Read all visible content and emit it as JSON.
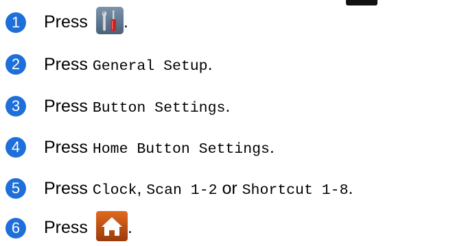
{
  "steps": [
    {
      "number": "1",
      "press": "Press",
      "suffix": "."
    },
    {
      "number": "2",
      "press": "Press",
      "menu": "General Setup",
      "suffix": "."
    },
    {
      "number": "3",
      "press": "Press",
      "menu": "Button Settings",
      "suffix": "."
    },
    {
      "number": "4",
      "press": "Press",
      "menu": "Home Button Settings",
      "suffix": "."
    },
    {
      "number": "5",
      "press": "Press",
      "opt1": "Clock",
      "comma": ",",
      "opt2": "Scan 1-2",
      "or": "or",
      "opt3": "Shortcut 1-8",
      "suffix": "."
    },
    {
      "number": "6",
      "press": "Press",
      "suffix": "."
    }
  ],
  "icons": {
    "settings": "tools-icon",
    "home": "home-icon"
  },
  "colors": {
    "step_badge": "#1e6fd9",
    "tools_button_bg": "#5a7188",
    "home_button_bg": "#b84a12"
  }
}
